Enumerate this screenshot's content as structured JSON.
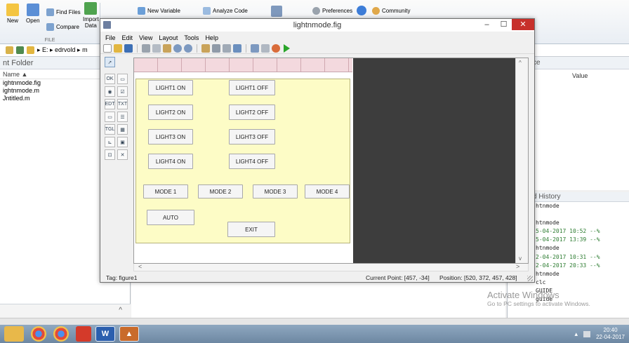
{
  "ribbon": {
    "new_label": "New",
    "open_label": "Open",
    "find_files_label": "Find Files",
    "compare_label": "Compare",
    "import_label": "Import\nData",
    "section_label": "FILE",
    "new_variable_label": "New Variable",
    "analyze_code_label": "Analyze Code",
    "preferences_label": "Preferences",
    "community_label": "Community"
  },
  "address_bar": {
    "path": "▸ E: ▸ edrvold ▸ m"
  },
  "left_panel": {
    "title": "nt Folder",
    "column_header": "Name ▲",
    "files": [
      "ightnmode.fig",
      "ightnmode.m",
      "Jntitled.m"
    ],
    "scroll_up": "^"
  },
  "right_panel": {
    "workspace_title": "ce",
    "value_column": "Value",
    "history_title": "d History",
    "history_lines": [
      {
        "text": "htnmode",
        "ts": false
      },
      {
        "text": "",
        "ts": false
      },
      {
        "text": "htnmode",
        "ts": false
      },
      {
        "text": "5-04-2017 10:52 --%",
        "ts": true
      },
      {
        "text": "5-04-2017 13:39 --%",
        "ts": true
      },
      {
        "text": "htnmode",
        "ts": false
      },
      {
        "text": "2-04-2017 10:31 --%",
        "ts": true
      },
      {
        "text": "2-04-2017 20:33 --%",
        "ts": true
      },
      {
        "text": "htnmode",
        "ts": false
      },
      {
        "text": "clc",
        "ts": false
      },
      {
        "text": "GUIDE",
        "ts": false
      },
      {
        "text": "guide",
        "ts": false
      }
    ],
    "activate_line1": "Activate Windows",
    "activate_line2": "Go to PC settings to activate Windows."
  },
  "guide_window": {
    "title": "lightnmode.fig",
    "minimize": "–",
    "maximize": "☐",
    "close": "✕",
    "menu": [
      "File",
      "Edit",
      "View",
      "Layout",
      "Tools",
      "Help"
    ],
    "status": {
      "tag": "Tag: figure1",
      "current_point": "Current Point:  [457, -34]",
      "position": "Position: [520, 372, 457, 428]"
    }
  },
  "gui_buttons": {
    "light1_on": "LIGHT1 ON",
    "light1_off": "LIGHT1 OFF",
    "light2_on": "LIGHT2 ON",
    "light2_off": "LIGHT2 OFF",
    "light3_on": "LIGHT3 ON",
    "light3_off": "LIGHT3 OFF",
    "light4_on": "LIGHT4 ON",
    "light4_off": "LIGHT4 OFF",
    "mode1": "MODE 1",
    "mode2": "MODE 2",
    "mode3": "MODE 3",
    "mode4": "MODE 4",
    "auto": "AUTO",
    "exit": "EXIT"
  },
  "taskbar": {
    "time": "20:40",
    "date": "22-04-2017"
  },
  "colors": {
    "figure_bg": "#fdfcc6",
    "grid_bg": "#f3d9de",
    "dark_area": "#3d3d3d",
    "close_button": "#c7302b"
  }
}
